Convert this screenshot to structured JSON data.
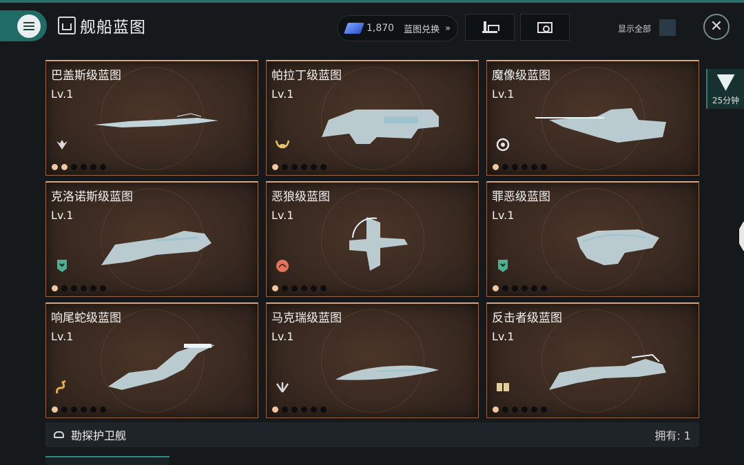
{
  "header": {
    "title": "舰船蓝图",
    "currency_amount": "1,870",
    "exchange_label": "蓝图兑换",
    "exchange_arrow": "»",
    "show_all_label": "显示全部",
    "close_symbol": "✕"
  },
  "side_tab": {
    "timer": "25分钟"
  },
  "cards": [
    {
      "name": "巴盖斯级蓝图",
      "level": "Lv.1",
      "faction_icon": "wing-emblem-icon",
      "faction_color": "#d8d8d8",
      "stars_on": 2,
      "stars_total": 6
    },
    {
      "name": "帕拉丁级蓝图",
      "level": "Lv.1",
      "faction_icon": "horns-emblem-icon",
      "faction_color": "#e8c36a",
      "stars_on": 1,
      "stars_total": 6
    },
    {
      "name": "魔像级蓝图",
      "level": "Lv.1",
      "faction_icon": "ring-emblem-icon",
      "faction_color": "#e8e8e8",
      "stars_on": 1,
      "stars_total": 6
    },
    {
      "name": "克洛诺斯级蓝图",
      "level": "Lv.1",
      "faction_icon": "shield-emblem-icon",
      "faction_color": "#4caf8f",
      "stars_on": 1,
      "stars_total": 6
    },
    {
      "name": "恶狼级蓝图",
      "level": "Lv.1",
      "faction_icon": "orb-emblem-icon",
      "faction_color": "#e0735a",
      "stars_on": 1,
      "stars_total": 6
    },
    {
      "name": "罪恶级蓝图",
      "level": "Lv.1",
      "faction_icon": "shield-emblem-icon",
      "faction_color": "#4caf8f",
      "stars_on": 1,
      "stars_total": 6
    },
    {
      "name": "响尾蛇级蓝图",
      "level": "Lv.1",
      "faction_icon": "serpent-emblem-icon",
      "faction_color": "#e3b04a",
      "stars_on": 1,
      "stars_total": 6
    },
    {
      "name": "马克瑞级蓝图",
      "level": "Lv.1",
      "faction_icon": "claw-emblem-icon",
      "faction_color": "#d8d8d8",
      "stars_on": 1,
      "stars_total": 6
    },
    {
      "name": "反击者级蓝图",
      "level": "Lv.1",
      "faction_icon": "book-emblem-icon",
      "faction_color": "#e3cf9a",
      "stars_on": 1,
      "stars_total": 6
    }
  ],
  "footer": {
    "ship_class": "勘探护卫舰",
    "owned": "拥有: 1"
  }
}
